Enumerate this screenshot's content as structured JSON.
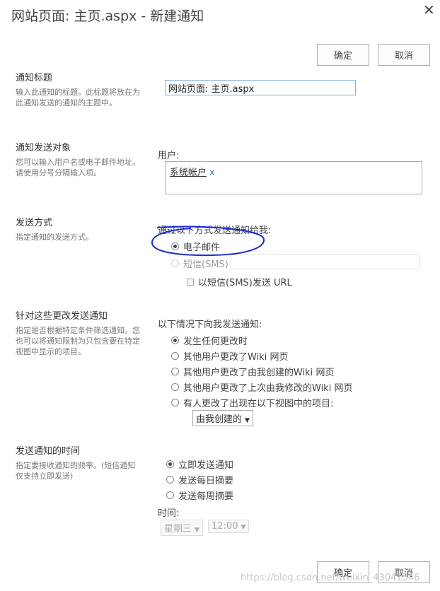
{
  "dialog": {
    "title": "网站页面: 主页.aspx - 新建通知",
    "ok_label": "确定",
    "cancel_label": "取消"
  },
  "alert_title": {
    "heading": "通知标题",
    "description": "输入此通知的标题。此标题将放在为此通知发送的通知的主题中。",
    "value": "网站页面: 主页.aspx"
  },
  "recipients": {
    "heading": "通知发送对象",
    "description": "您可以输入用户名或电子邮件地址。请使用分号分隔输入项。",
    "users_label": "用户:",
    "user": "系统帐户",
    "remove_glyph": "x"
  },
  "delivery": {
    "heading": "发送方式",
    "description": "指定通知的发送方式。",
    "prompt": "通过以下方式发送通知给我:",
    "email_label": "电子邮件",
    "sms_label": "短信(SMS)",
    "sms_value": "",
    "sms_url_label": "以短信(SMS)发送 URL"
  },
  "changes": {
    "heading": "针对这些更改发送通知",
    "description": "指定是否根据特定条件筛选通知。您也可以将通知限制为只包含要在特定视图中显示的项目。",
    "prompt": "以下情况下向我发送通知:",
    "options": [
      "发生任何更改时",
      "其他用户更改了Wiki 网页",
      "其他用户更改了由我创建的Wiki 网页",
      "其他用户更改了上次由我修改的Wiki 网页",
      "有人更改了出现在以下视图中的项目:"
    ],
    "view_select": "由我创建的"
  },
  "timing": {
    "heading": "发送通知的时间",
    "description": "指定要接收通知的频率。(短信通知仅支持立即发送)",
    "options": [
      "立即发送通知",
      "发送每日摘要",
      "发送每周摘要"
    ],
    "time_label": "时间:",
    "day_select": "星期三",
    "time_select": "12:00"
  },
  "watermark": "https://blog.csdn.net/weixin_43041546",
  "colors": {
    "annotation": "#1a2ad0",
    "link": "#2a7fc8",
    "input_border": "#80b3e0"
  }
}
